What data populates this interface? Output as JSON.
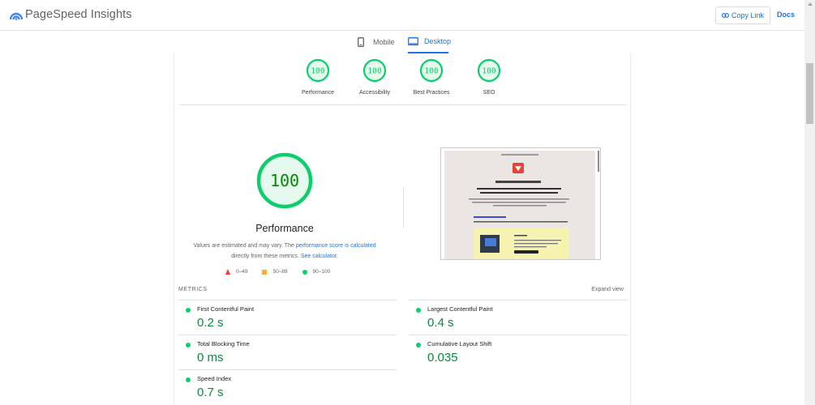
{
  "header": {
    "brand": "PageSpeed Insights",
    "copy_link": "Copy Link",
    "docs": "Docs"
  },
  "tabs": [
    {
      "label": "Mobile",
      "active": false
    },
    {
      "label": "Desktop",
      "active": true
    }
  ],
  "categories": [
    {
      "score": "100",
      "label": "Performance"
    },
    {
      "score": "100",
      "label": "Accessibility"
    },
    {
      "score": "100",
      "label": "Best Practices"
    },
    {
      "score": "100",
      "label": "SEO"
    }
  ],
  "performance": {
    "score": "100",
    "title": "Performance",
    "desc_1": "Values are estimated and may vary. The ",
    "desc_link1": "performance score is calculated",
    "desc_2": " directly from these metrics. ",
    "desc_link2": "See calculator."
  },
  "legend": [
    {
      "range": "0–49",
      "color": "#ff3333"
    },
    {
      "range": "50–89",
      "color": "#ffaa33"
    },
    {
      "range": "90–100",
      "color": "#0cce6b"
    }
  ],
  "metrics_section": {
    "label": "METRICS",
    "expand": "Expand view"
  },
  "metrics": [
    {
      "name": "First Contentful Paint",
      "value": "0.2 s"
    },
    {
      "name": "Largest Contentful Paint",
      "value": "0.4 s"
    },
    {
      "name": "Total Blocking Time",
      "value": "0 ms"
    },
    {
      "name": "Cumulative Layout Shift",
      "value": "0.035"
    },
    {
      "name": "Speed Index",
      "value": "0.7 s"
    }
  ],
  "colors": {
    "accent": "#1a73e8",
    "pass": "#0cce6b",
    "pass_text": "#008800"
  }
}
